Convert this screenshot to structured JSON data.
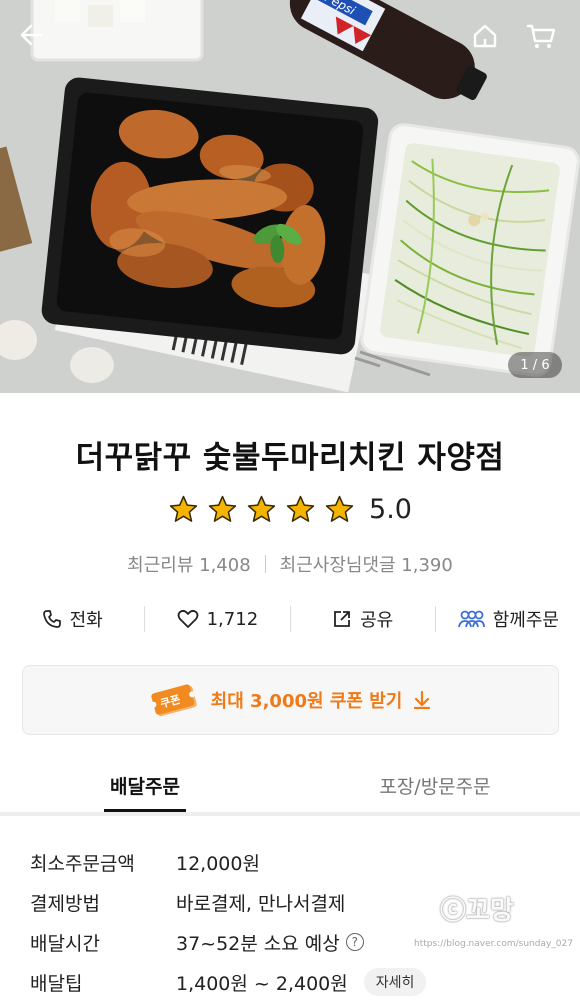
{
  "hero": {
    "image_counter": "1 / 6",
    "bottle_label": "Pepsi"
  },
  "nav": {
    "back": "back-arrow",
    "home": "home-icon",
    "cart": "cart-icon"
  },
  "store": {
    "name": "더꾸닭꾸 숯불두마리치킨 자양점",
    "rating": 5.0,
    "rating_text": "5.0",
    "reviews": "최근리뷰 1,408",
    "owner_replies": "최근사장님댓글 1,390"
  },
  "actions": {
    "call": "전화",
    "likes": "1,712",
    "share": "공유",
    "group_order": "함께주문"
  },
  "coupon": {
    "badge": "쿠폰",
    "text": "최대 3,000원 쿠폰 받기"
  },
  "tabs": [
    {
      "label": "배달주문",
      "active": true
    },
    {
      "label": "포장/방문주문",
      "active": false
    }
  ],
  "info": [
    {
      "label": "최소주문금액",
      "value": "12,000원"
    },
    {
      "label": "결제방법",
      "value": "바로결제, 만나서결제"
    },
    {
      "label": "배달시간",
      "value": "37~52분 소요 예상",
      "help": "?"
    },
    {
      "label": "배달팁",
      "value": "1,400원 ~ 2,400원",
      "button": "자세히"
    }
  ],
  "watermark": {
    "text": "ⓒ꼬망",
    "url": "https://blog.naver.com/sunday_027"
  },
  "colors": {
    "accent": "#f07a16",
    "star": "#f5b400",
    "group_icon": "#3e6fd8"
  }
}
